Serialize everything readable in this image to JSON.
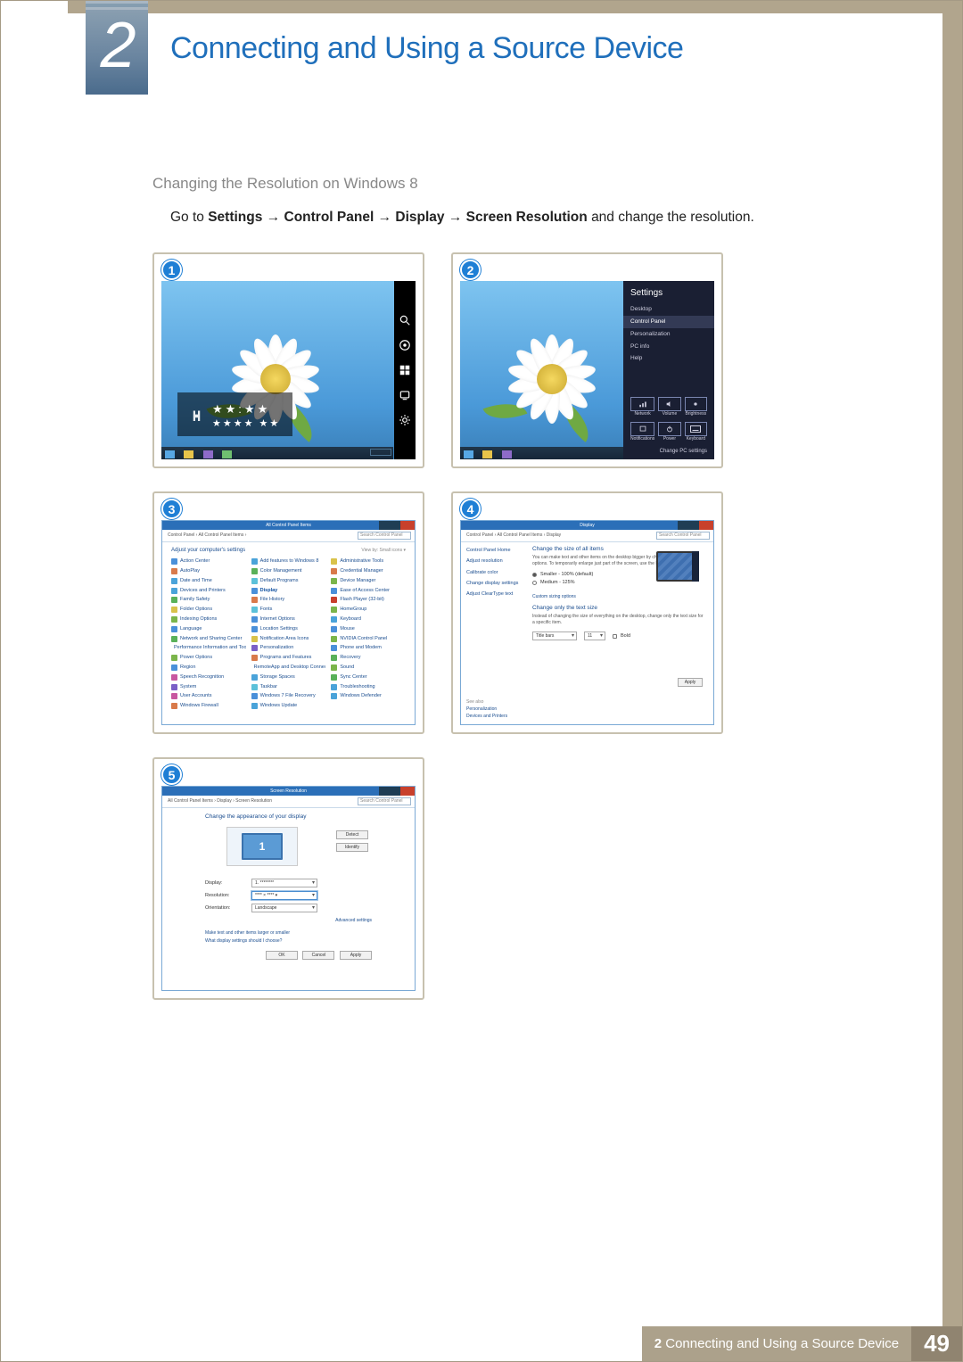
{
  "chapter": {
    "number": "2",
    "title": "Connecting and Using a Source Device"
  },
  "section_title": "Changing the Resolution on Windows 8",
  "instruction": {
    "prefix": "Go to ",
    "path": [
      "Settings",
      "Control Panel",
      "Display",
      "Screen Resolution"
    ],
    "suffix": " and change the resolution."
  },
  "steps": {
    "s1": "1",
    "s2": "2",
    "s3": "3",
    "s4": "4",
    "s5": "5"
  },
  "charms": {
    "search": "Search",
    "share": "Share",
    "start": "Start",
    "devices": "Devices",
    "settings": "Settings"
  },
  "time_overlay": {
    "line1": "★★:★★",
    "line2": "★★★★ ★★"
  },
  "settings": {
    "title": "Settings",
    "items": [
      "Desktop",
      "Control Panel",
      "Personalization",
      "PC info",
      "Help"
    ],
    "selected_index": 1,
    "bottom_icons": [
      {
        "label": "Network"
      },
      {
        "label": "Volume"
      },
      {
        "label": "Brightness"
      },
      {
        "label": "Notifications"
      },
      {
        "label": "Power"
      },
      {
        "label": "Keyboard"
      }
    ],
    "change_pc": "Change PC settings"
  },
  "control_panel": {
    "title": "All Control Panel Items",
    "breadcrumb": "Control Panel › All Control Panel Items ›",
    "search_placeholder": "Search Control Panel",
    "adjust": "Adjust your computer's settings",
    "view": "View by:   Small icons ▾",
    "items_col1": [
      "Action Center",
      "AutoPlay",
      "Date and Time",
      "Devices and Printers",
      "Family Safety",
      "Folder Options",
      "Indexing Options",
      "Language",
      "Network and Sharing Center",
      "Performance Information and Tools",
      "Power Options",
      "Region",
      "Speech Recognition",
      "System",
      "User Accounts",
      "Windows Firewall"
    ],
    "items_col2": [
      "Add features to Windows 8",
      "Color Management",
      "Default Programs",
      "Display",
      "File History",
      "Fonts",
      "Internet Options",
      "Location Settings",
      "Notification Area Icons",
      "Personalization",
      "Programs and Features",
      "RemoteApp and Desktop Connections",
      "Storage Spaces",
      "Taskbar",
      "Windows 7 File Recovery",
      "Windows Update"
    ],
    "items_col3": [
      "Administrative Tools",
      "Credential Manager",
      "Device Manager",
      "Ease of Access Center",
      "Flash Player (32-bit)",
      "HomeGroup",
      "Keyboard",
      "Mouse",
      "NVIDIA Control Panel",
      "Phone and Modem",
      "Recovery",
      "Sound",
      "Sync Center",
      "Troubleshooting",
      "Windows Defender",
      ""
    ],
    "icon_colors_col1": [
      "#4a90d9",
      "#d97a4a",
      "#4aa3d9",
      "#4aa3d9",
      "#59b159",
      "#d9c24a",
      "#7bb54a",
      "#4a90d9",
      "#59b159",
      "#4a90d9",
      "#7bb54a",
      "#4a90d9",
      "#c857a0",
      "#7b5fc7",
      "#c857a0",
      "#d97a4a"
    ],
    "icon_colors_col2": [
      "#4aa3d9",
      "#59b159",
      "#5cc1d9",
      "#4a90d9",
      "#d97a4a",
      "#5cc1d9",
      "#4a90d9",
      "#4a90d9",
      "#d9c24a",
      "#7b5fc7",
      "#d97a4a",
      "#d9c24a",
      "#4aa3d9",
      "#5cc1d9",
      "#4a90d9",
      "#4aa3d9"
    ],
    "icon_colors_col3": [
      "#d9c24a",
      "#d97a4a",
      "#7bb54a",
      "#4a90d9",
      "#c8402c",
      "#7bb54a",
      "#4aa3d9",
      "#4a90d9",
      "#7bb54a",
      "#4a90d9",
      "#59b159",
      "#7bb54a",
      "#59b159",
      "#4aa3d9",
      "#4aa3d9",
      "#ffffff"
    ],
    "highlight": "Display"
  },
  "display": {
    "title": "Display",
    "breadcrumb": "Control Panel › All Control Panel Items › Display",
    "search_placeholder": "Search Control Panel",
    "sidebar": {
      "home": "Control Panel Home",
      "items": [
        "Adjust resolution",
        "Calibrate color",
        "Change display settings",
        "Adjust ClearType text"
      ]
    },
    "main_title": "Change the size of all items",
    "main_text": "You can make text and other items on the desktop bigger by choosing one of these options. To temporarily enlarge just part of the screen, use the Magnifier tool.",
    "radio1": "Smaller - 100% (default)",
    "radio2": "Medium - 125%",
    "custom": "Custom sizing options",
    "text_title": "Change only the text size",
    "text_text": "Instead of changing the size of everything on the desktop, change only the text size for a specific item.",
    "dropdown_label": "Title bars",
    "dropdown_val": "11",
    "bold": "Bold",
    "apply": "Apply",
    "see_also": "See also",
    "see_items": [
      "Personalization",
      "Devices and Printers"
    ]
  },
  "screen_res": {
    "title": "Screen Resolution",
    "breadcrumb": "All Control Panel Items › Display › Screen Resolution",
    "search_placeholder": "Search Control Panel",
    "main_title": "Change the appearance of your display",
    "monitor_label": "1",
    "detect": "Detect",
    "identify": "Identify",
    "fields": {
      "display_label": "Display:",
      "display_value": "1. ********",
      "resolution_label": "Resolution:",
      "resolution_value": "**** × **** ▾",
      "orientation_label": "Orientation:",
      "orientation_value": "Landscape"
    },
    "advanced": "Advanced settings",
    "link1": "Make text and other items larger or smaller",
    "link2": "What display settings should I choose?",
    "ok": "OK",
    "cancel": "Cancel",
    "apply": "Apply"
  },
  "footer": {
    "chapter": "2",
    "text": "Connecting and Using a Source Device",
    "page": "49"
  }
}
